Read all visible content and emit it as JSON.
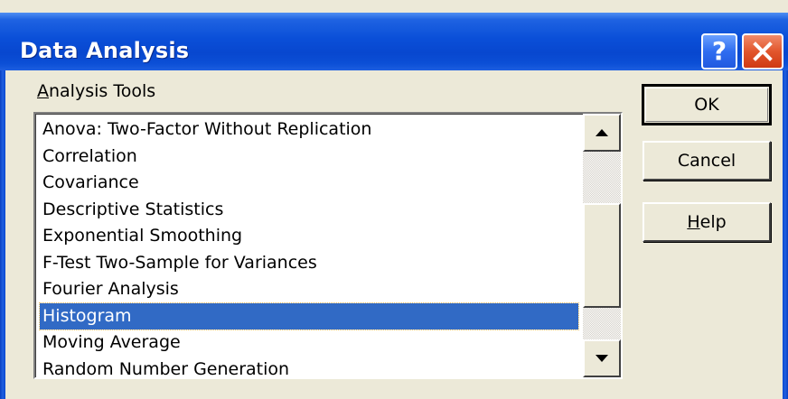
{
  "window": {
    "title": "Data Analysis",
    "help_glyph": "?",
    "close_icon": "close-x-icon"
  },
  "group": {
    "label_first": "A",
    "label_rest": "nalysis Tools"
  },
  "list": {
    "items": [
      "Anova: Two-Factor Without Replication",
      "Correlation",
      "Covariance",
      "Descriptive Statistics",
      "Exponential Smoothing",
      "F-Test Two-Sample for Variances",
      "Fourier Analysis",
      "Histogram",
      "Moving Average",
      "Random Number Generation"
    ],
    "selected": "Histogram"
  },
  "buttons": {
    "ok": "OK",
    "cancel": "Cancel",
    "help_first": "H",
    "help_rest": "elp"
  },
  "colors": {
    "title_bar": "#0a4fd8",
    "selection": "#316ac5",
    "dialog_bg": "#ece9d8",
    "close_button": "#e2562c"
  }
}
